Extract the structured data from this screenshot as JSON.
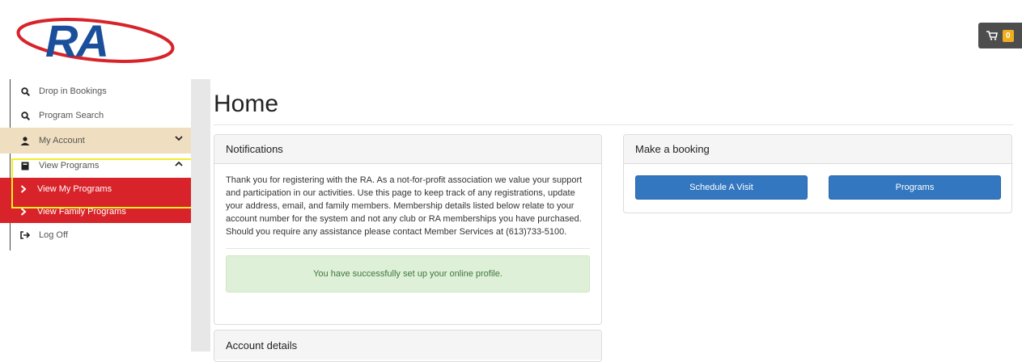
{
  "logo": {
    "text": "RA"
  },
  "cart": {
    "count": "0"
  },
  "sidebar": {
    "items": [
      {
        "label": "Drop in Bookings"
      },
      {
        "label": "Program Search"
      },
      {
        "label": "My Account"
      },
      {
        "label": "View Programs"
      },
      {
        "label": "View My Programs"
      },
      {
        "label": "View Family Programs"
      },
      {
        "label": "Log Off"
      }
    ]
  },
  "page": {
    "title": "Home"
  },
  "notifications": {
    "heading": "Notifications",
    "body": "Thank you for registering with the RA. As a not-for-profit association we value your support and participation in our activities. Use this page to keep track of any registrations, update your address, email, and family members. Membership details listed below relate to your account number for the system and not any club or RA memberships you have purchased. Should you require any assistance please contact Member Services at (613)733-5100.",
    "success": "You have successfully set up your online profile."
  },
  "account": {
    "heading": "Account details"
  },
  "booking": {
    "heading": "Make a booking",
    "schedule_label": "Schedule A Visit",
    "programs_label": "Programs"
  }
}
